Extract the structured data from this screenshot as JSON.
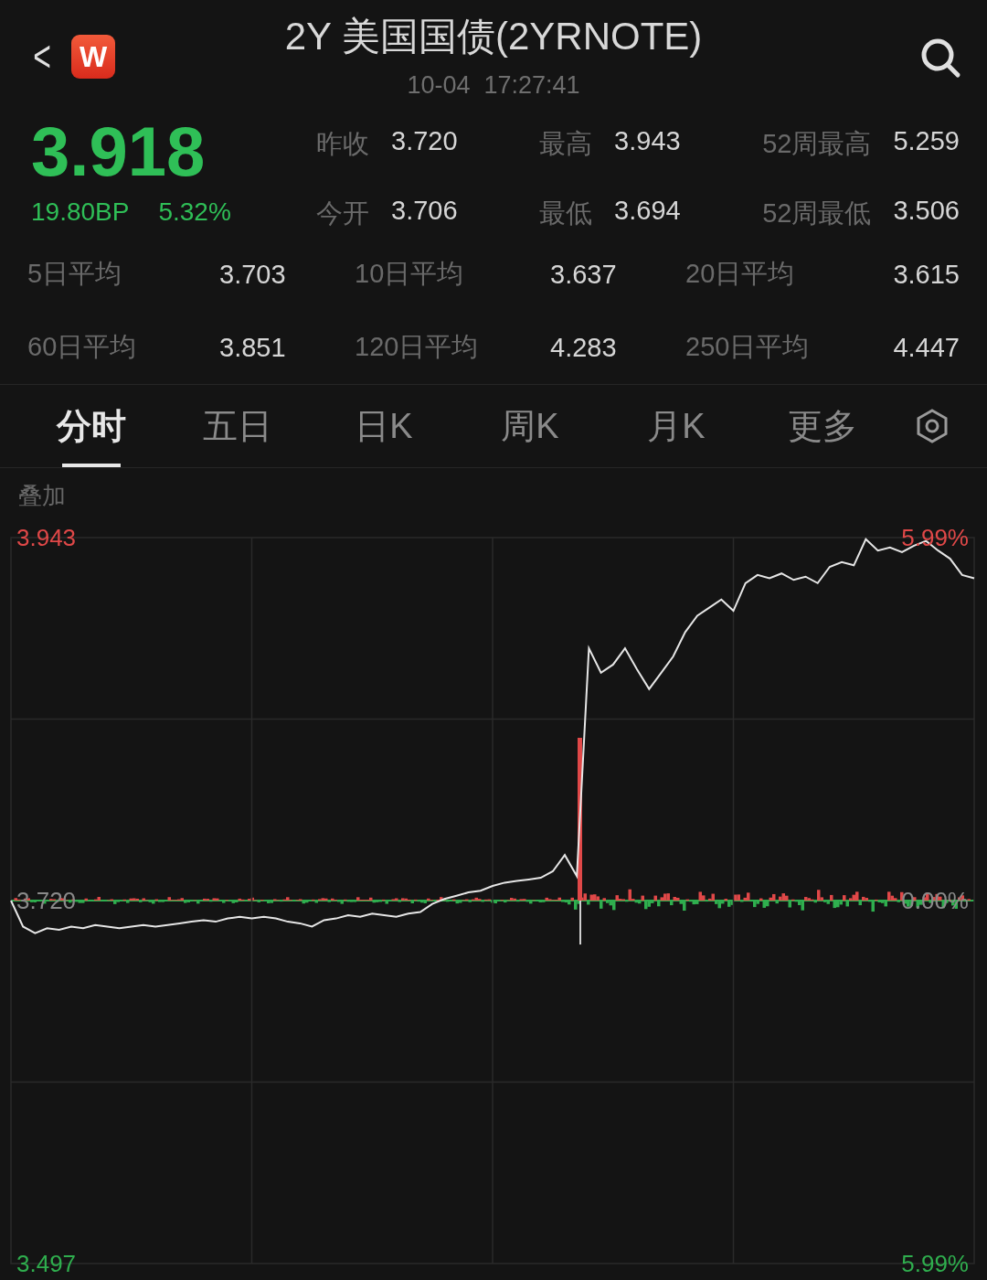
{
  "header": {
    "back": "<",
    "logo_text": "W",
    "title": "2Y 美国国债(2YRNOTE)",
    "time": "10-04  17:27:41"
  },
  "quote": {
    "price": "3.918",
    "change_bp": "19.80BP",
    "change_pct": "5.32%"
  },
  "stats": [
    {
      "label": "昨收",
      "value": "3.720"
    },
    {
      "label": "最高",
      "value": "3.943"
    },
    {
      "label": "52周最高",
      "value": "5.259"
    },
    {
      "label": "今开",
      "value": "3.706"
    },
    {
      "label": "最低",
      "value": "3.694"
    },
    {
      "label": "52周最低",
      "value": "3.506"
    }
  ],
  "averages": [
    {
      "label": "5日平均",
      "value": "3.703"
    },
    {
      "label": "10日平均",
      "value": "3.637"
    },
    {
      "label": "20日平均",
      "value": "3.615"
    },
    {
      "label": "60日平均",
      "value": "3.851"
    },
    {
      "label": "120日平均",
      "value": "4.283"
    },
    {
      "label": "250日平均",
      "value": "4.447"
    }
  ],
  "tabs": [
    {
      "label": "分时",
      "selected": true
    },
    {
      "label": "五日",
      "selected": false
    },
    {
      "label": "日K",
      "selected": false
    },
    {
      "label": "周K",
      "selected": false
    },
    {
      "label": "月K",
      "selected": false
    },
    {
      "label": "更多",
      "selected": false
    }
  ],
  "chart": {
    "overlay_label": "叠加",
    "right_labels": [
      {
        "text": "5.99%",
        "color": "#e04848"
      },
      {
        "text": "0.00%",
        "color": "#8a8a8a"
      },
      {
        "text": "5.99%",
        "color": "#2fae4e"
      }
    ],
    "chart_data": {
      "type": "line",
      "grid": true,
      "ylim": [
        3.497,
        3.943
      ],
      "yticks": [
        {
          "value": 3.943,
          "label": "3.943"
        },
        {
          "value": 3.72,
          "label": "3.720"
        },
        {
          "value": 3.497,
          "label": "3.497"
        }
      ],
      "series": [
        {
          "color": "#e6e6e6",
          "values": [
            3.72,
            3.704,
            3.7,
            3.703,
            3.702,
            3.704,
            3.703,
            3.705,
            3.704,
            3.703,
            3.704,
            3.705,
            3.704,
            3.705,
            3.706,
            3.707,
            3.708,
            3.707,
            3.709,
            3.71,
            3.709,
            3.71,
            3.709,
            3.707,
            3.706,
            3.704,
            3.708,
            3.709,
            3.711,
            3.71,
            3.712,
            3.711,
            3.71,
            3.712,
            3.713,
            3.718,
            3.721,
            3.723,
            3.725,
            3.726,
            3.729,
            3.731,
            3.732,
            3.733,
            3.734,
            3.738,
            3.748,
            3.735,
            3.875,
            3.86,
            3.865,
            3.875,
            3.862,
            3.85,
            3.86,
            3.87,
            3.885,
            3.895,
            3.9,
            3.905,
            3.898,
            3.915,
            3.92,
            3.918,
            3.921,
            3.917,
            3.919,
            3.915,
            3.925,
            3.928,
            3.926,
            3.942,
            3.935,
            3.937,
            3.934,
            3.938,
            3.941,
            3.935,
            3.93,
            3.92,
            3.918
          ]
        }
      ]
    }
  }
}
